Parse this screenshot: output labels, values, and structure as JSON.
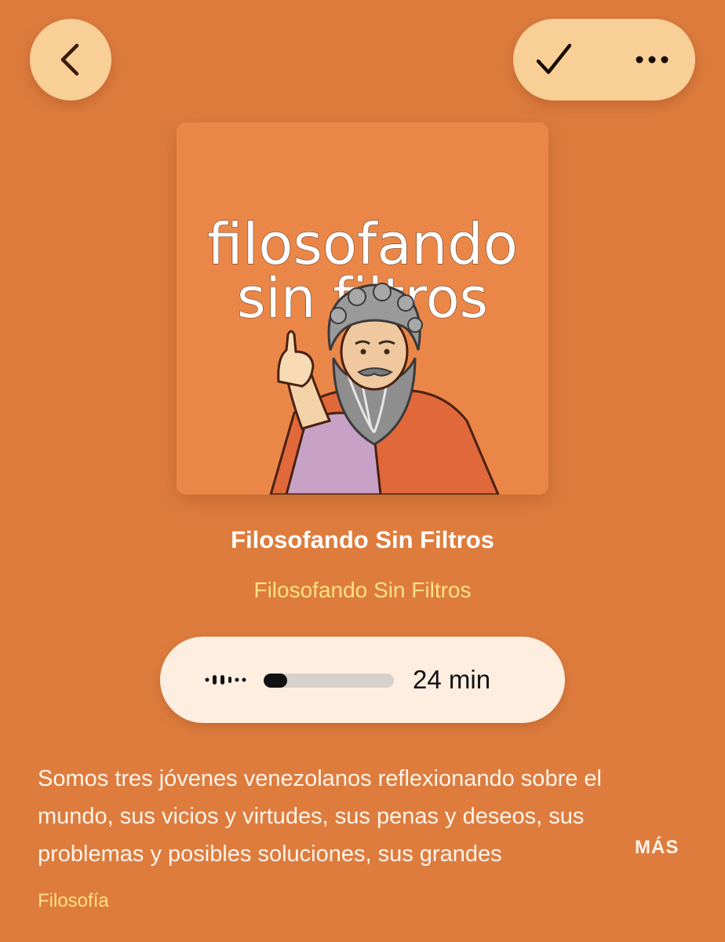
{
  "header": {
    "back_icon": "chevron-left-icon",
    "check_icon": "checkmark-icon",
    "more_icon": "ellipsis-icon"
  },
  "artwork": {
    "title_line1": "filosofando",
    "title_line2": "sin filtros"
  },
  "episode": {
    "title": "Filosofando Sin Filtros",
    "show_name": "Filosofando Sin Filtros"
  },
  "player": {
    "play_icon": "play-waveform-icon",
    "progress": 0.18,
    "duration": "24 min"
  },
  "description": {
    "text": "Somos tres jóvenes venezolanos reflexionando sobre el mundo, sus vicios y virtudes, sus penas y deseos, sus problemas y posibles soluciones, sus grandes",
    "more_label": "MÁS"
  },
  "category": "Filosofía",
  "colors": {
    "background": "#de7c3e",
    "button": "#f8cf96",
    "accent_yellow": "#ffe183",
    "pill": "#fdeee0"
  }
}
